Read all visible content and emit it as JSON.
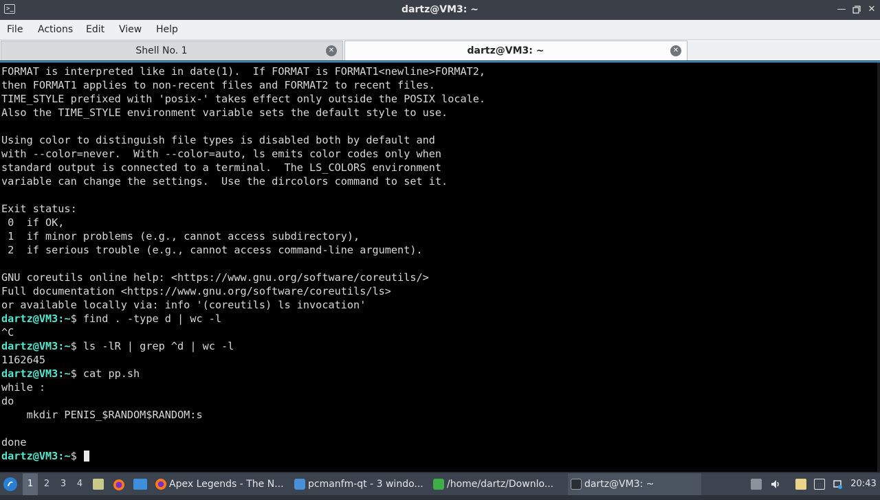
{
  "window": {
    "title": "dartz@VM3: ~"
  },
  "menu": [
    "File",
    "Actions",
    "Edit",
    "View",
    "Help"
  ],
  "tabs": [
    {
      "label": "Shell No. 1",
      "active": false
    },
    {
      "label": "dartz@VM3: ~",
      "active": true
    }
  ],
  "terminal": {
    "colors": {
      "prompt": "#55e6cf",
      "text": "#d8d8d8",
      "background": "#000000"
    },
    "lines": [
      {
        "text": "FORMAT is interpreted like in date(1).  If FORMAT is FORMAT1<newline>FORMAT2,"
      },
      {
        "text": "then FORMAT1 applies to non-recent files and FORMAT2 to recent files."
      },
      {
        "text": "TIME_STYLE prefixed with 'posix-' takes effect only outside the POSIX locale."
      },
      {
        "text": "Also the TIME_STYLE environment variable sets the default style to use."
      },
      {
        "text": ""
      },
      {
        "text": "Using color to distinguish file types is disabled both by default and"
      },
      {
        "text": "with --color=never.  With --color=auto, ls emits color codes only when"
      },
      {
        "text": "standard output is connected to a terminal.  The LS_COLORS environment"
      },
      {
        "text": "variable can change the settings.  Use the dircolors command to set it."
      },
      {
        "text": ""
      },
      {
        "text": "Exit status:"
      },
      {
        "text": " 0  if OK,"
      },
      {
        "text": " 1  if minor problems (e.g., cannot access subdirectory),"
      },
      {
        "text": " 2  if serious trouble (e.g., cannot access command-line argument)."
      },
      {
        "text": ""
      },
      {
        "text": "GNU coreutils online help: <https://www.gnu.org/software/coreutils/>"
      },
      {
        "text": "Full documentation <https://www.gnu.org/software/coreutils/ls>"
      },
      {
        "text": "or available locally via: info '(coreutils) ls invocation'"
      },
      {
        "prompt": "dartz@VM3:~",
        "text": "$ find . -type d | wc -l"
      },
      {
        "text": "^C"
      },
      {
        "prompt": "dartz@VM3:~",
        "text": "$ ls -lR | grep ^d | wc -l"
      },
      {
        "text": "1162645"
      },
      {
        "prompt": "dartz@VM3:~",
        "text": "$ cat pp.sh"
      },
      {
        "text": "while :"
      },
      {
        "text": "do"
      },
      {
        "text": "    mkdir PENIS_$RANDOM$RANDOM:s"
      },
      {
        "text": ""
      },
      {
        "text": "done"
      },
      {
        "prompt": "dartz@VM3:~",
        "text": "$ ",
        "cursor": true
      }
    ]
  },
  "taskbar": {
    "desktops": [
      "1",
      "2",
      "3",
      "4"
    ],
    "active_desktop": "1",
    "tasks": [
      {
        "label": "Apex Legends - The N...",
        "icon": "firefox-icon"
      },
      {
        "label": "pcmanfm-qt - 3 windo...",
        "icon": "folder-icon"
      },
      {
        "label": "/home/dartz/Downlo...",
        "icon": "archive-icon"
      },
      {
        "label": "dartz@VM3: ~",
        "icon": "terminal-icon"
      }
    ],
    "clock": "20:43"
  }
}
